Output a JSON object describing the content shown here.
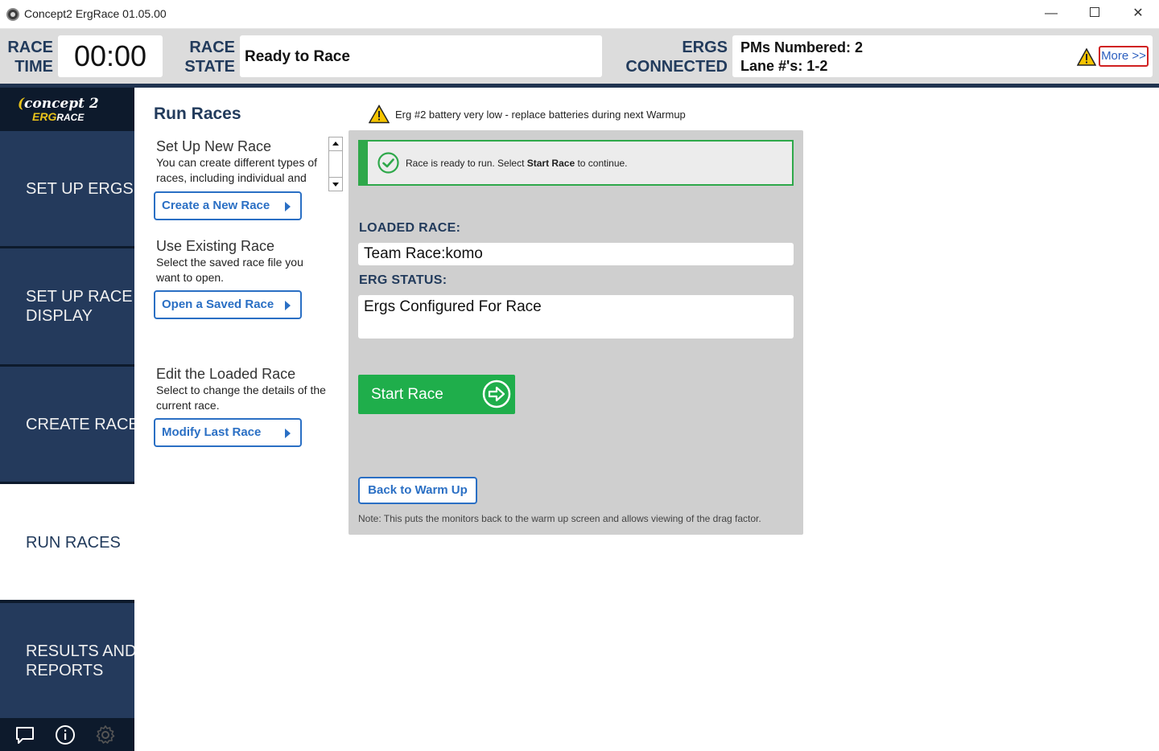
{
  "window": {
    "title": "Concept2 ErgRace 01.05.00",
    "minimize_glyph": "—",
    "close_glyph": "✕"
  },
  "status": {
    "race_time_label_1": "RACE",
    "race_time_label_2": "TIME",
    "race_time_value": "00:00",
    "race_state_label_1": "RACE",
    "race_state_label_2": "STATE",
    "race_state_value": "Ready to Race",
    "ergs_label_1": "ERGS",
    "ergs_label_2": "CONNECTED",
    "pms_numbered": "PMs Numbered: 2",
    "lanes": "Lane #'s: 1-2",
    "more_label": "More >>"
  },
  "sidebar": {
    "logo_brand": "concept 2",
    "logo_erg": "ERG",
    "logo_race": "RACE",
    "items": [
      {
        "line1": "SET UP ERGS",
        "line2": ""
      },
      {
        "line1": "SET UP RACE",
        "line2": "DISPLAY"
      },
      {
        "line1": "CREATE RACE",
        "line2": ""
      },
      {
        "line1": "RUN RACES",
        "line2": ""
      },
      {
        "line1": "RESULTS AND",
        "line2": "REPORTS"
      }
    ]
  },
  "main": {
    "title": "Run Races",
    "warning": "Erg #2 battery very low - replace batteries during next Warmup",
    "options": [
      {
        "title": "Set Up New Race",
        "desc": "You can create different types of races, including individual and team races.",
        "button": "Create a New Race"
      },
      {
        "title": "Use Existing Race",
        "desc": "Select the saved race file you want to open.",
        "button": "Open a Saved Race"
      },
      {
        "title": "Edit the Loaded Race",
        "desc": "Select to change the details of the current race.",
        "button": "Modify Last Race"
      }
    ]
  },
  "panel": {
    "ready_prefix": "Race is ready to run.  Select ",
    "ready_bold": "Start Race",
    "ready_suffix": " to continue.",
    "loaded_race_label": "LOADED RACE:",
    "loaded_race_value": "Team Race:komo",
    "erg_status_label": "ERG STATUS:",
    "erg_status_value": "Ergs Configured For Race",
    "start_button": "Start Race",
    "back_button": "Back to Warm Up",
    "note": "Note:  This puts the monitors back to the warm up screen and allows viewing of the drag factor."
  },
  "colors": {
    "navy": "#223b5c",
    "sidebar_item": "#243a5c",
    "green": "#1fae4b",
    "link_blue": "#2a6fc4",
    "warning_yellow": "#f5c400"
  },
  "icons": {
    "warning": "warning-triangle-icon",
    "check": "check-circle-icon",
    "start": "arrow-circle-right-icon",
    "chat": "chat-icon",
    "info": "info-icon",
    "settings": "gear-icon"
  }
}
